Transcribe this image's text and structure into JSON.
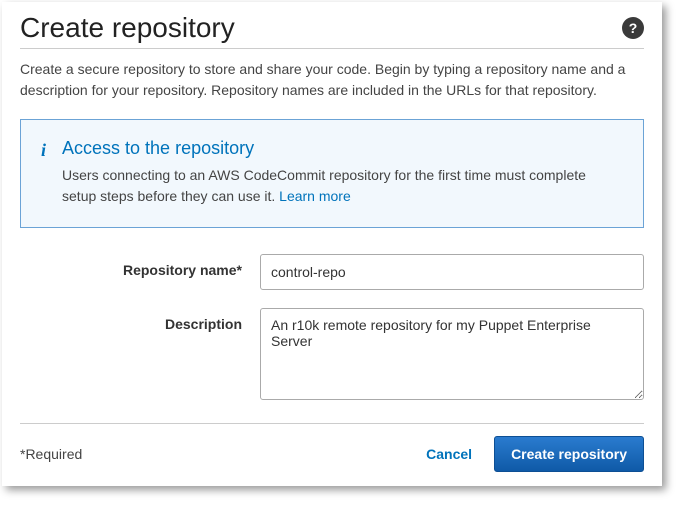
{
  "header": {
    "title": "Create repository"
  },
  "intro": "Create a secure repository to store and share your code. Begin by typing a repository name and a description for your repository. Repository names are included in the URLs for that repository.",
  "infoBox": {
    "title": "Access to the repository",
    "text": "Users connecting to an AWS CodeCommit repository for the first time must complete setup steps before they can use it. ",
    "learnMore": "Learn more"
  },
  "form": {
    "repoName": {
      "label": "Repository name*",
      "value": "control-repo"
    },
    "description": {
      "label": "Description",
      "value": "An r10k remote repository for my Puppet Enterprise Server"
    }
  },
  "footer": {
    "requiredNote": "*Required",
    "cancel": "Cancel",
    "submit": "Create repository"
  }
}
